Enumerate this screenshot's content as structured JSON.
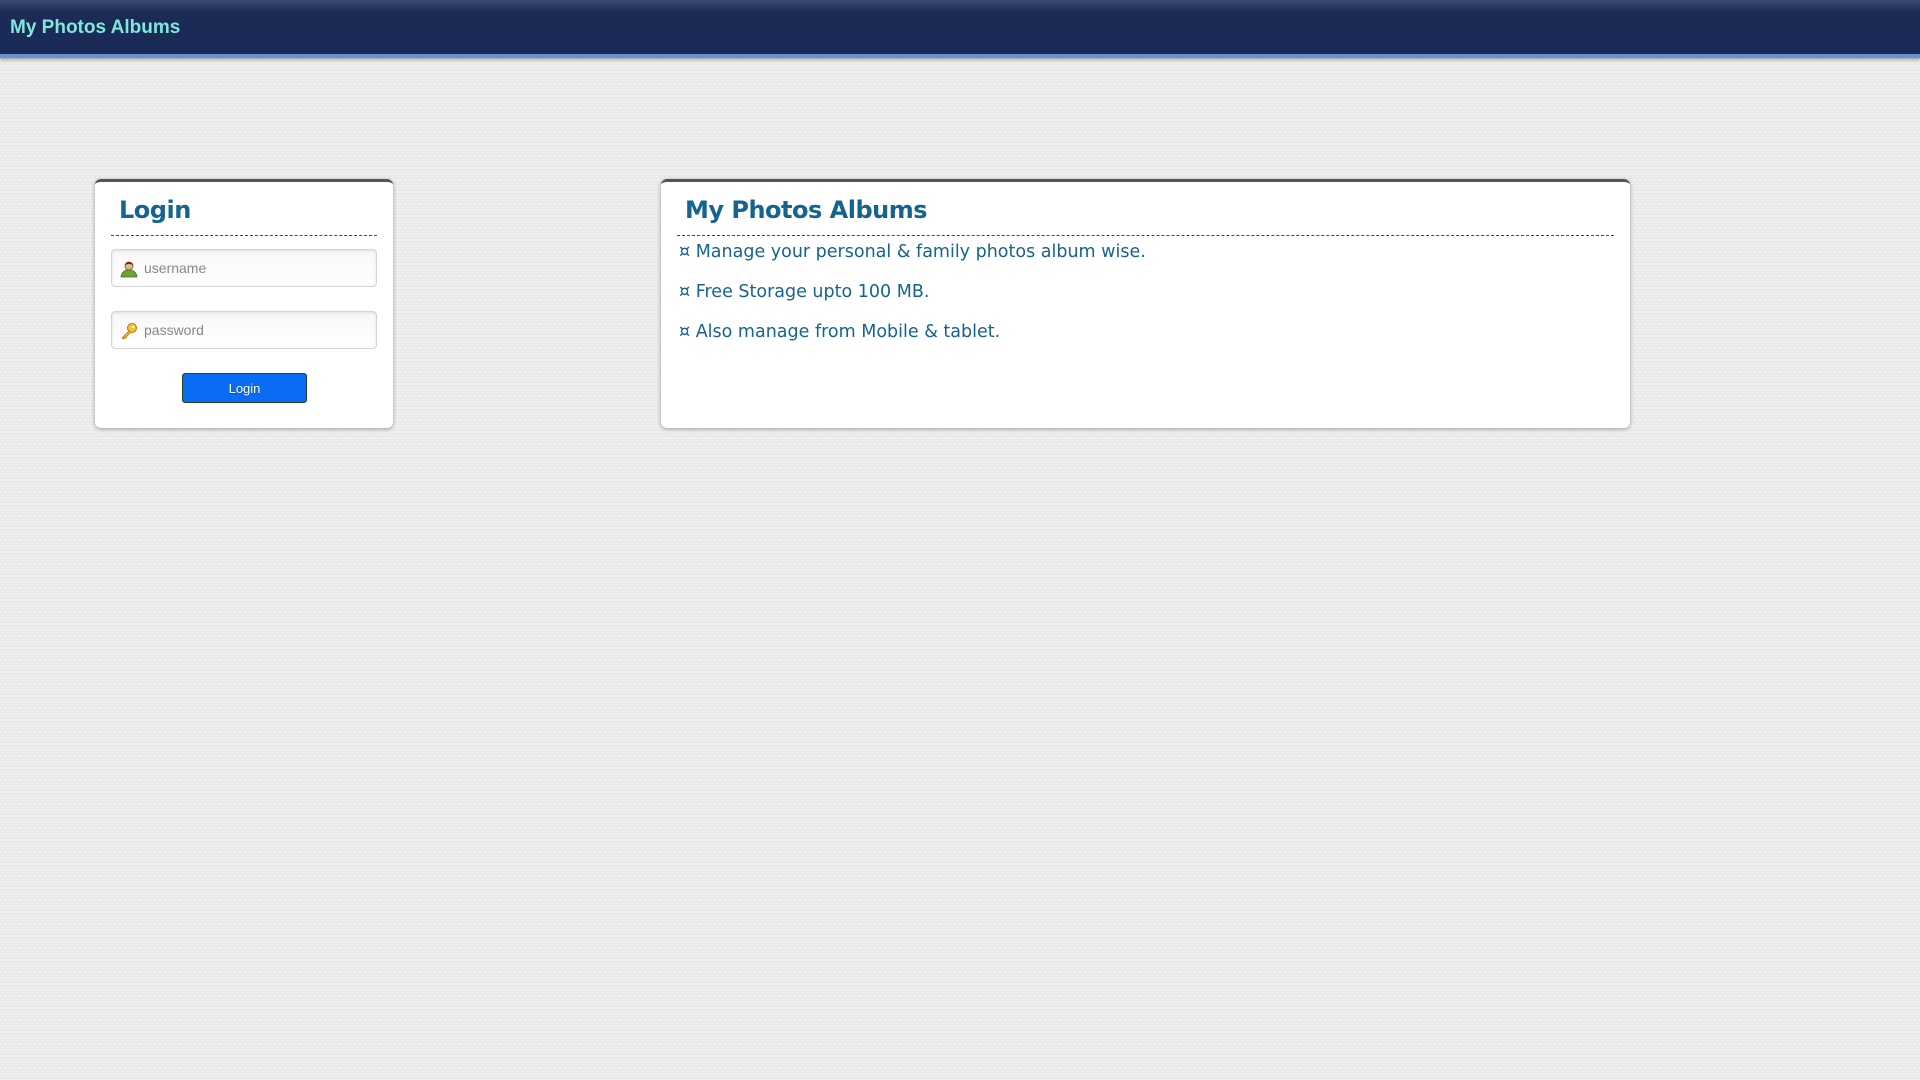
{
  "header": {
    "title": "My Photos Albums"
  },
  "login": {
    "title": "Login",
    "username_placeholder": "username",
    "password_placeholder": "password",
    "button_label": "Login"
  },
  "info": {
    "title": "My Photos Albums",
    "items": [
      "¤ Manage your personal & family photos album wise.",
      "¤ Free Storage upto 100 MB.",
      "¤ Also manage from Mobile & tablet."
    ]
  }
}
